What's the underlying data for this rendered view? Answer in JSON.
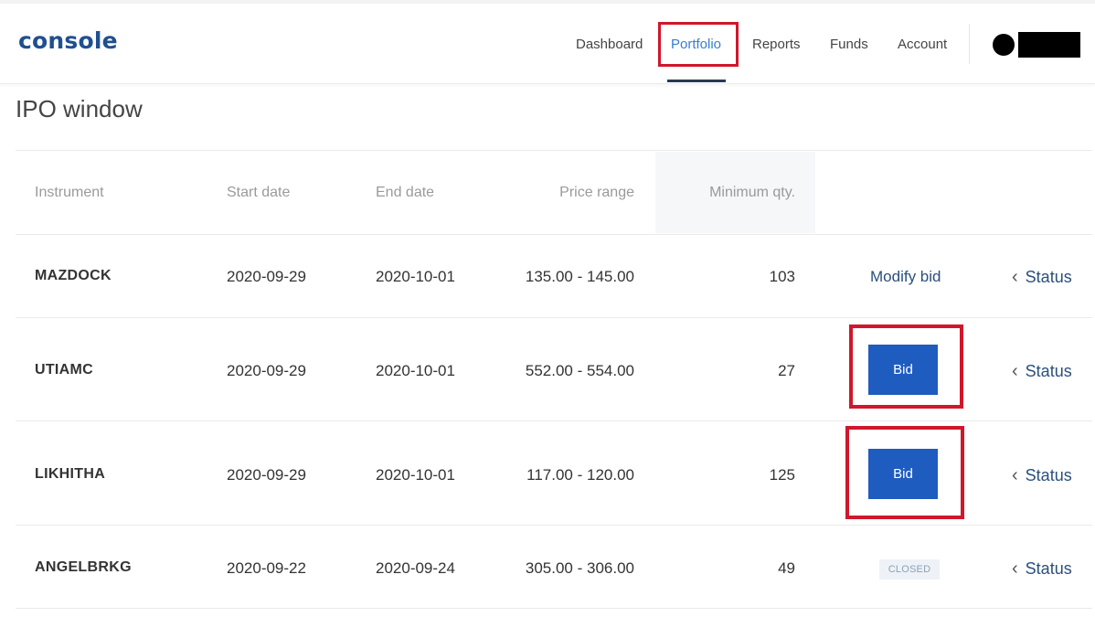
{
  "app": {
    "logo": "console"
  },
  "nav": {
    "items": [
      {
        "label": "Dashboard"
      },
      {
        "label": "Portfolio"
      },
      {
        "label": "Reports"
      },
      {
        "label": "Funds"
      },
      {
        "label": "Account"
      }
    ],
    "active": "Portfolio"
  },
  "page": {
    "title": "IPO window"
  },
  "table": {
    "headers": [
      "Instrument",
      "Start date",
      "End date",
      "Price range",
      "Minimum qty."
    ],
    "rows": [
      {
        "instrument": "MAZDOCK",
        "start": "2020-09-29",
        "end": "2020-10-01",
        "price": "135.00 - 145.00",
        "qty": "103",
        "action": "Modify bid",
        "status": "Status"
      },
      {
        "instrument": "UTIAMC",
        "start": "2020-09-29",
        "end": "2020-10-01",
        "price": "552.00 - 554.00",
        "qty": "27",
        "action": "Bid",
        "status": "Status"
      },
      {
        "instrument": "LIKHITHA",
        "start": "2020-09-29",
        "end": "2020-10-01",
        "price": "117.00 - 120.00",
        "qty": "125",
        "action": "Bid",
        "status": "Status"
      },
      {
        "instrument": "ANGELBRKG",
        "start": "2020-09-22",
        "end": "2020-09-24",
        "price": "305.00 - 306.00",
        "qty": "49",
        "action": "CLOSED",
        "status": "Status"
      }
    ]
  },
  "colors": {
    "accent": "#387ed1",
    "bid_button": "#1f5cc0",
    "highlight": "#d0172b",
    "logo": "#1f4f8f"
  },
  "icons": {
    "status_chevron": "chevron-left-icon"
  }
}
